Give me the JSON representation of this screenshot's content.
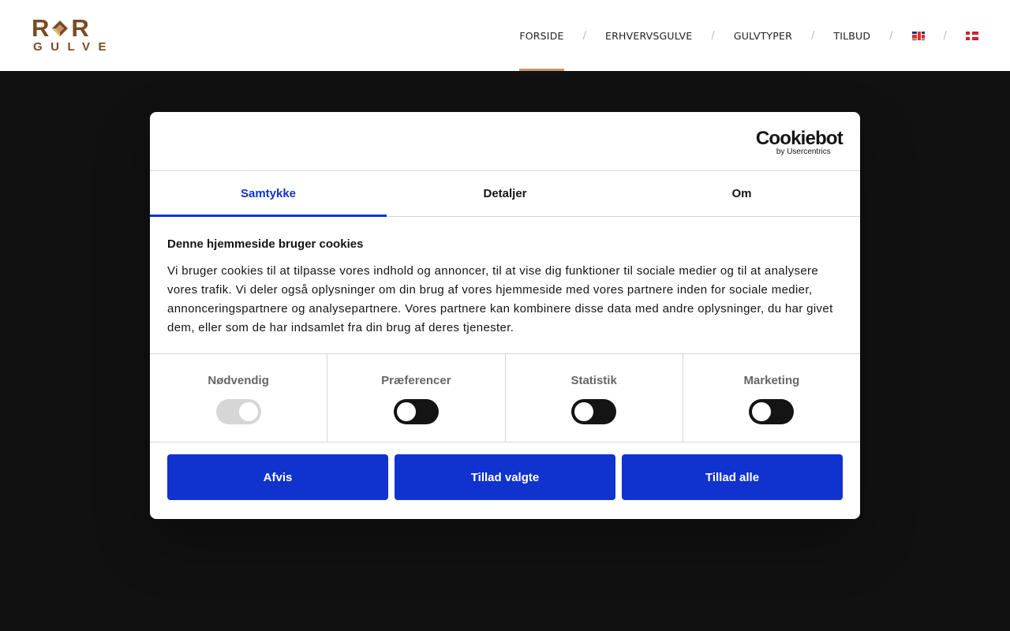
{
  "header": {
    "logo": {
      "top_left": "R",
      "top_right": "R",
      "bottom": "GULVE",
      "color": "#7a4a24"
    },
    "nav": [
      {
        "label": "FORSIDE",
        "active": true
      },
      {
        "label": "ERHVERVSGULVE"
      },
      {
        "label": "GULVTYPER"
      },
      {
        "label": "TILBUD"
      }
    ],
    "separator": "/",
    "active_color": "#c8946a"
  },
  "dialog": {
    "brand": {
      "name": "Cookiebot",
      "sub": "by Usercentrics"
    },
    "tabs": [
      "Samtykke",
      "Detaljer",
      "Om"
    ],
    "active_tab": "Samtykke",
    "title": "Denne hjemmeside bruger cookies",
    "text": "Vi bruger cookies til at tilpasse vores indhold og annoncer, til at vise dig funktioner til sociale medier og til at analysere vores trafik. Vi deler også oplysninger om din brug af vores hjemmeside med vores partnere inden for sociale medier, annonceringspartnere og analysepartnere. Vores partnere kan kombinere disse data med andre oplysninger, du har givet dem, eller som de har indsamlet fra din brug af deres tjenester.",
    "toggles": [
      {
        "label": "Nødvendig",
        "state": "on-disabled"
      },
      {
        "label": "Præferencer",
        "state": "off"
      },
      {
        "label": "Statistik",
        "state": "off"
      },
      {
        "label": "Marketing",
        "state": "off"
      }
    ],
    "buttons": {
      "deny": "Afvis",
      "allow_selected": "Tillad valgte",
      "allow_all": "Tillad alle"
    },
    "accent_color": "#1032cf"
  }
}
